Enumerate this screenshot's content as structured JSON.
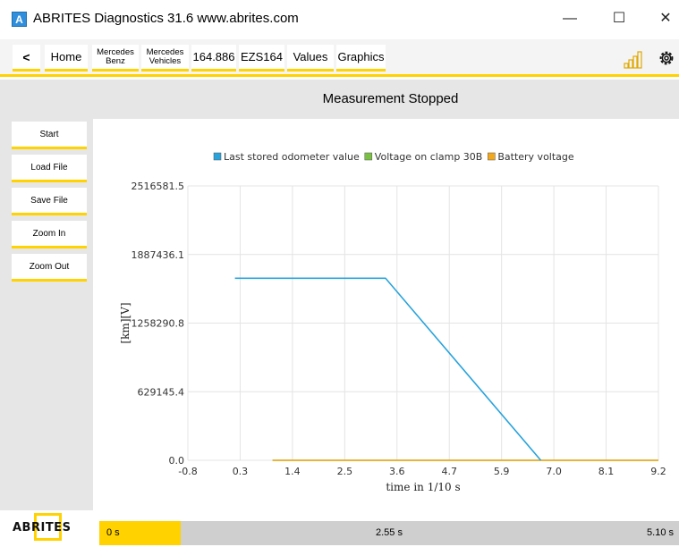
{
  "window": {
    "icon_letter": "A",
    "title": "ABRITES Diagnostics 31.6   www.abrites.com",
    "minimize_glyph": "—",
    "maximize_glyph": "☐",
    "close_glyph": "✕"
  },
  "breadcrumb": {
    "back": "<",
    "items": [
      {
        "label": "Home"
      },
      {
        "label_line1": "Mercedes",
        "label_line2": "Benz"
      },
      {
        "label_line1": "Mercedes",
        "label_line2": "Vehicles"
      },
      {
        "label": "164.886"
      },
      {
        "label": "EZS164"
      },
      {
        "label": "Values"
      },
      {
        "label": "Graphics"
      }
    ],
    "signal_icon": "signal-bars-icon",
    "settings_icon": "gear-icon"
  },
  "status": {
    "text": "Measurement Stopped"
  },
  "side_buttons": {
    "start": "Start",
    "load": "Load File",
    "save": "Save File",
    "zoom_in": "Zoom In",
    "zoom_out": "Zoom Out"
  },
  "colors": {
    "accent": "#ffd200",
    "odometer": "#29a3dc",
    "clamp30b": "#7ac143",
    "battery": "#f2a81d"
  },
  "chart_data": {
    "type": "line",
    "xlabel": "time in 1/10 s",
    "ylabel": "[km][V]",
    "xlim": [
      -0.8,
      9.2
    ],
    "ylim": [
      0.0,
      2516581.5
    ],
    "x_ticks": [
      "-0.8",
      "0.3",
      "1.4",
      "2.5",
      "3.6",
      "4.7",
      "5.9",
      "7.0",
      "8.1",
      "9.2"
    ],
    "y_ticks": [
      "0.0",
      "629145.4",
      "1258290.8",
      "1887436.1",
      "2516581.5"
    ],
    "grid": true,
    "legend_position": "top",
    "series": [
      {
        "name": "Last stored odometer value",
        "color": "#29a3dc",
        "points": [
          [
            0.2,
            1670000
          ],
          [
            3.4,
            1670000
          ],
          [
            6.7,
            0
          ]
        ]
      },
      {
        "name": "Voltage on clamp 30B",
        "color": "#7ac143",
        "points": [
          [
            1.0,
            0
          ],
          [
            9.2,
            0
          ]
        ]
      },
      {
        "name": "Battery voltage",
        "color": "#f2a81d",
        "points": [
          [
            1.0,
            0
          ],
          [
            9.2,
            0
          ]
        ]
      }
    ]
  },
  "timeline": {
    "start": "0 s",
    "mid": "2.55 s",
    "end": "5.10 s",
    "progress_fraction": 0.14
  },
  "logo": {
    "text": "ABRITES"
  }
}
